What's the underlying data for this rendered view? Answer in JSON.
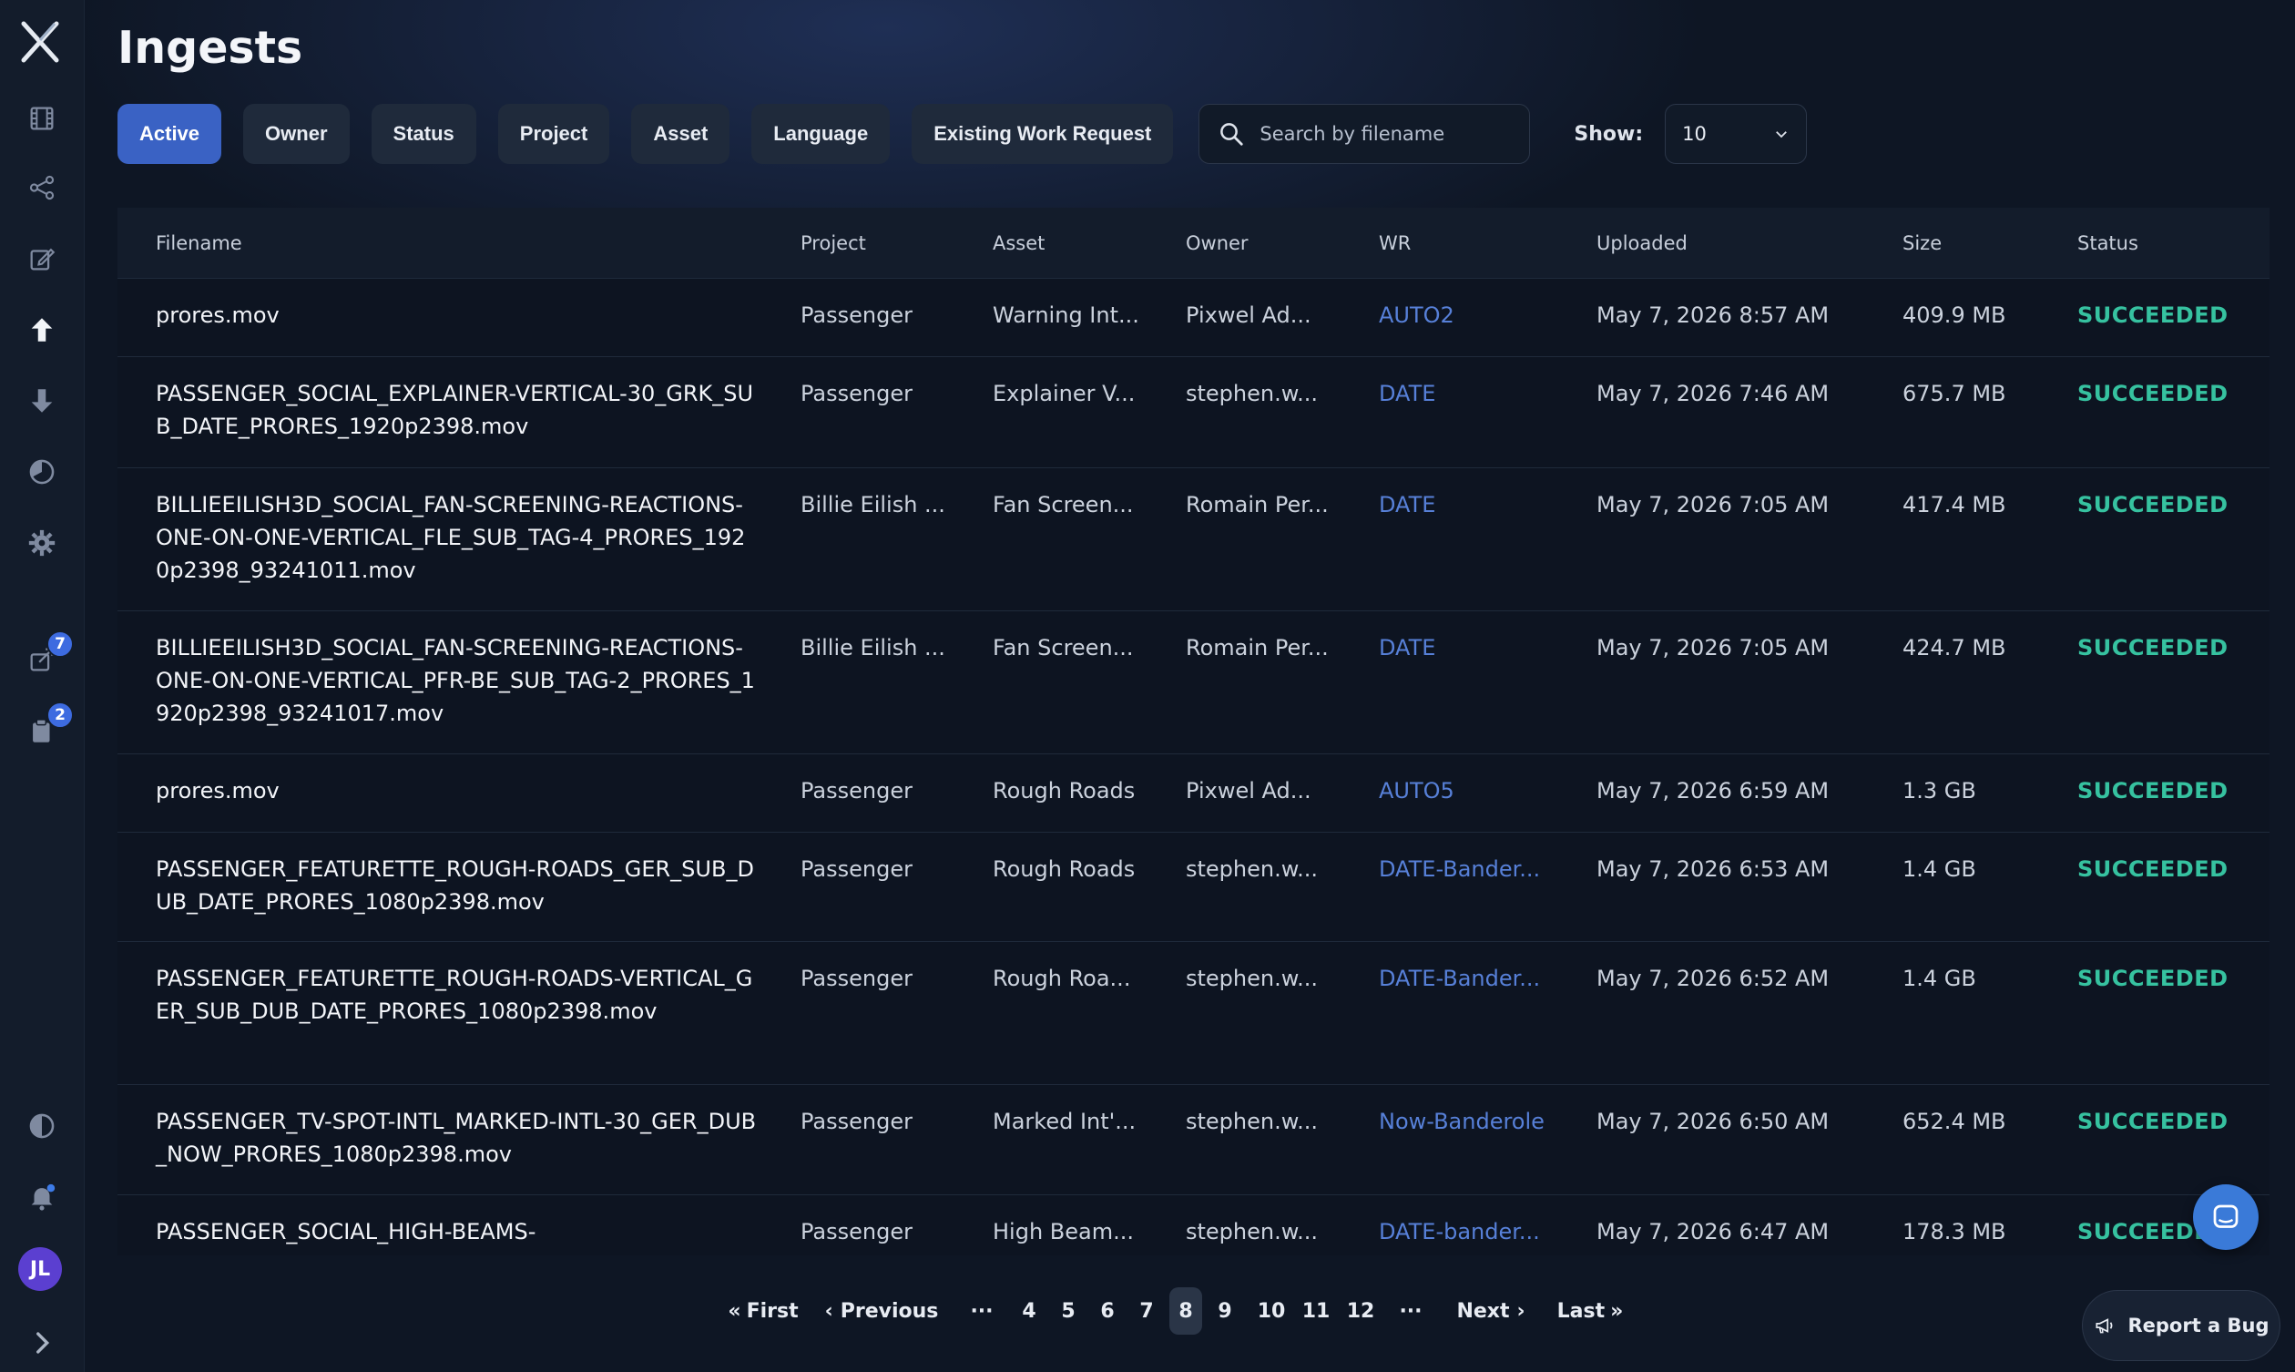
{
  "page": {
    "title": "Ingests"
  },
  "filters": [
    {
      "label": "Active",
      "active": true
    },
    {
      "label": "Owner"
    },
    {
      "label": "Status"
    },
    {
      "label": "Project"
    },
    {
      "label": "Asset"
    },
    {
      "label": "Language"
    },
    {
      "label": "Existing Work Request"
    }
  ],
  "search": {
    "placeholder": "Search by filename",
    "value": ""
  },
  "show": {
    "label": "Show:",
    "value": "10"
  },
  "sidebar": {
    "icons": [
      "film-icon",
      "share-icon",
      "edit-icon",
      "upload-icon",
      "download-icon",
      "pie-chart-icon",
      "gear-icon"
    ],
    "badges": {
      "requests": "7",
      "clipboard": "2"
    },
    "avatar_initials": "JL"
  },
  "table": {
    "columns": [
      "Filename",
      "Project",
      "Asset",
      "Owner",
      "WR",
      "Uploaded",
      "Size",
      "Status"
    ],
    "rows": [
      {
        "filename": "prores.mov",
        "project": "Passenger",
        "asset": "Warning Int...",
        "owner": "Pixwel Ad...",
        "wr": "AUTO2",
        "uploaded": "May 7, 2026 8:57 AM",
        "size": "409.9 MB",
        "status": "SUCCEEDED"
      },
      {
        "filename": "PASSENGER_SOCIAL_EXPLAINER-VERTICAL-30_GRK_SUB_DATE_PRORES_1920p2398.mov",
        "project": "Passenger",
        "asset": "Explainer V...",
        "owner": "stephen.w...",
        "wr": "DATE",
        "uploaded": "May 7, 2026 7:46 AM",
        "size": "675.7 MB",
        "status": "SUCCEEDED"
      },
      {
        "filename": "BILLIEEILISH3D_SOCIAL_FAN-SCREENING-REACTIONS-ONE-ON-ONE-VERTICAL_FLE_SUB_TAG-4_PRORES_1920p2398_93241011.mov",
        "project": "Billie Eilish ...",
        "asset": "Fan Screen...",
        "owner": "Romain Per...",
        "wr": "DATE",
        "uploaded": "May 7, 2026 7:05 AM",
        "size": "417.4 MB",
        "status": "SUCCEEDED"
      },
      {
        "filename": "BILLIEEILISH3D_SOCIAL_FAN-SCREENING-REACTIONS-ONE-ON-ONE-VERTICAL_PFR-BE_SUB_TAG-2_PRORES_1920p2398_93241017.mov",
        "project": "Billie Eilish ...",
        "asset": "Fan Screen...",
        "owner": "Romain Per...",
        "wr": "DATE",
        "uploaded": "May 7, 2026 7:05 AM",
        "size": "424.7 MB",
        "status": "SUCCEEDED"
      },
      {
        "filename": "prores.mov",
        "project": "Passenger",
        "asset": "Rough Roads",
        "owner": "Pixwel Ad...",
        "wr": "AUTO5",
        "uploaded": "May 7, 2026 6:59 AM",
        "size": "1.3 GB",
        "status": "SUCCEEDED"
      },
      {
        "filename": "PASSENGER_FEATURETTE_ROUGH-ROADS_GER_SUB_DUB_DATE_PRORES_1080p2398.mov",
        "project": "Passenger",
        "asset": "Rough Roads",
        "owner": "stephen.w...",
        "wr": "DATE-Bander...",
        "uploaded": "May 7, 2026 6:53 AM",
        "size": "1.4 GB",
        "status": "SUCCEEDED"
      },
      {
        "filename": "PASSENGER_FEATURETTE_ROUGH-ROADS-VERTICAL_GER_SUB_DUB_DATE_PRORES_1080p2398.mov",
        "project": "Passenger",
        "asset": "Rough Roa...",
        "owner": "stephen.w...",
        "wr": "DATE-Bander...",
        "uploaded": "May 7, 2026 6:52 AM",
        "size": "1.4 GB",
        "status": "SUCCEEDED"
      },
      {
        "filename": "PASSENGER_TV-SPOT-INTL_MARKED-INTL-30_GER_DUB_NOW_PRORES_1080p2398.mov",
        "project": "Passenger",
        "asset": "Marked Int'...",
        "owner": "stephen.w...",
        "wr": "Now-Banderole",
        "uploaded": "May 7, 2026 6:50 AM",
        "size": "652.4 MB",
        "status": "SUCCEEDED"
      },
      {
        "filename": "PASSENGER_SOCIAL_HIGH-BEAMS-",
        "project": "Passenger",
        "asset": "High Beam...",
        "owner": "stephen.w...",
        "wr": "DATE-bander...",
        "uploaded": "May 7, 2026 6:47 AM",
        "size": "178.3 MB",
        "status": "SUCCEEDED"
      }
    ]
  },
  "pagination": {
    "first": "First",
    "previous": "Previous",
    "ellipsis": "···",
    "pages": [
      "4",
      "5",
      "6",
      "7",
      "8",
      "9",
      "10",
      "11",
      "12"
    ],
    "current": "8",
    "next": "Next",
    "last": "Last"
  },
  "report_bug": {
    "label": "Report a Bug"
  },
  "colors": {
    "accent": "#3a62c4",
    "success": "#36c2a0",
    "link": "#5780d8",
    "background": "#0e1624"
  }
}
